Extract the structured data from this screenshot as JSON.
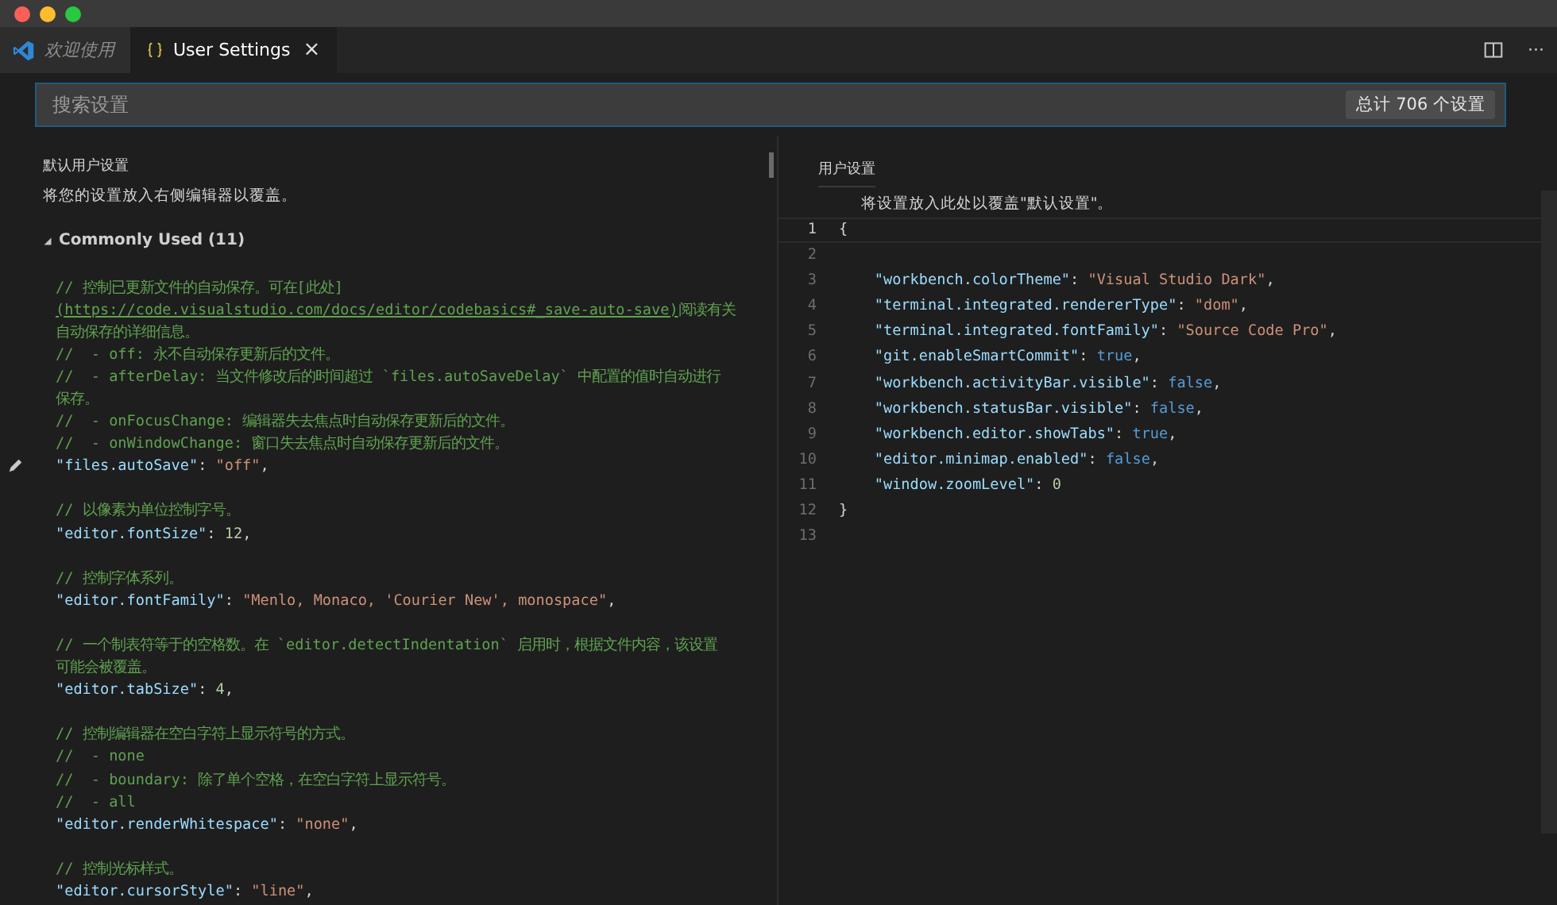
{
  "tabs": [
    {
      "label": "欢迎使用",
      "kind": "welcome",
      "selected": false
    },
    {
      "label": "User Settings",
      "kind": "settings",
      "selected": true,
      "close": "×"
    }
  ],
  "toolbar": {
    "more": "···"
  },
  "search": {
    "placeholder": "搜索设置",
    "count": "总计 706 个设置"
  },
  "default_pane": {
    "title": "默认用户设置",
    "hint": "将您的设置放入右侧编辑器以覆盖。",
    "group": {
      "label": "Commonly Used (11)",
      "expanded": true
    },
    "entries": [
      {
        "edited": true,
        "lines": [
          [
            {
              "kind": "comment",
              "text": "// 控制已更新文件的自动保存。可在[此处]"
            }
          ],
          [
            {
              "kind": "link",
              "text": "(https://code.visualstudio.com/docs/editor/codebasics#_save-auto-save)"
            },
            {
              "kind": "comment",
              "text": "阅读有关"
            }
          ],
          [
            {
              "kind": "comment",
              "text": "自动保存的详细信息。"
            }
          ],
          [
            {
              "kind": "comment",
              "text": "//  - off: 永不自动保存更新后的文件。"
            }
          ],
          [
            {
              "kind": "comment",
              "text": "//  - afterDelay: 当文件修改后的时间超过 `files.autoSaveDelay` 中配置的值时自动进行"
            }
          ],
          [
            {
              "kind": "comment",
              "text": "保存。"
            }
          ],
          [
            {
              "kind": "comment",
              "text": "//  - onFocusChange: 编辑器失去焦点时自动保存更新后的文件。"
            }
          ],
          [
            {
              "kind": "comment",
              "text": "//  - onWindowChange: 窗口失去焦点时自动保存更新后的文件。"
            }
          ],
          [
            {
              "kind": "key",
              "text": "\"files.autoSave\""
            },
            {
              "kind": "punct",
              "text": ": "
            },
            {
              "kind": "string",
              "text": "\"off\""
            },
            {
              "kind": "punct",
              "text": ","
            }
          ]
        ]
      },
      {
        "edited": false,
        "lines": [
          [
            {
              "kind": "comment",
              "text": "// 以像素为单位控制字号。"
            }
          ],
          [
            {
              "kind": "key",
              "text": "\"editor.fontSize\""
            },
            {
              "kind": "punct",
              "text": ": "
            },
            {
              "kind": "number",
              "text": "12"
            },
            {
              "kind": "punct",
              "text": ","
            }
          ]
        ]
      },
      {
        "edited": false,
        "lines": [
          [
            {
              "kind": "comment",
              "text": "// 控制字体系列。"
            }
          ],
          [
            {
              "kind": "key",
              "text": "\"editor.fontFamily\""
            },
            {
              "kind": "punct",
              "text": ": "
            },
            {
              "kind": "string",
              "text": "\"Menlo, Monaco, 'Courier New', monospace\""
            },
            {
              "kind": "punct",
              "text": ","
            }
          ]
        ]
      },
      {
        "edited": false,
        "lines": [
          [
            {
              "kind": "comment",
              "text": "// 一个制表符等于的空格数。在 `editor.detectIndentation` 启用时，根据文件内容，该设置"
            }
          ],
          [
            {
              "kind": "comment",
              "text": "可能会被覆盖。"
            }
          ],
          [
            {
              "kind": "key",
              "text": "\"editor.tabSize\""
            },
            {
              "kind": "punct",
              "text": ": "
            },
            {
              "kind": "number",
              "text": "4"
            },
            {
              "kind": "punct",
              "text": ","
            }
          ]
        ]
      },
      {
        "edited": false,
        "lines": [
          [
            {
              "kind": "comment",
              "text": "// 控制编辑器在空白字符上显示符号的方式。"
            }
          ],
          [
            {
              "kind": "comment",
              "text": "//  - none"
            }
          ],
          [
            {
              "kind": "comment",
              "text": "//  - boundary: 除了单个空格，在空白字符上显示符号。"
            }
          ],
          [
            {
              "kind": "comment",
              "text": "//  - all"
            }
          ],
          [
            {
              "kind": "key",
              "text": "\"editor.renderWhitespace\""
            },
            {
              "kind": "punct",
              "text": ": "
            },
            {
              "kind": "string",
              "text": "\"none\""
            },
            {
              "kind": "punct",
              "text": ","
            }
          ]
        ]
      },
      {
        "edited": false,
        "lines": [
          [
            {
              "kind": "comment",
              "text": "// 控制光标样式。"
            }
          ],
          [
            {
              "kind": "key",
              "text": "\"editor.cursorStyle\""
            },
            {
              "kind": "punct",
              "text": ": "
            },
            {
              "kind": "string",
              "text": "\"line\""
            },
            {
              "kind": "punct",
              "text": ","
            }
          ]
        ]
      }
    ]
  },
  "user_pane": {
    "title": "用户设置",
    "hint": "将设置放入此处以覆盖\"默认设置\"。",
    "lines": [
      {
        "number": "1",
        "current": true,
        "tokens": [
          {
            "kind": "punct",
            "text": "{"
          }
        ]
      },
      {
        "number": "2",
        "current": false
      },
      {
        "number": "3",
        "current": false,
        "tokens": [
          {
            "kind": "key",
            "text": "    \"workbench.colorTheme\""
          },
          {
            "kind": "punct",
            "text": ": "
          },
          {
            "kind": "string",
            "text": "\"Visual Studio Dark\""
          },
          {
            "kind": "punct",
            "text": ","
          }
        ]
      },
      {
        "number": "4",
        "current": false,
        "tokens": [
          {
            "kind": "key",
            "text": "    \"terminal.integrated.rendererType\""
          },
          {
            "kind": "punct",
            "text": ": "
          },
          {
            "kind": "string",
            "text": "\"dom\""
          },
          {
            "kind": "punct",
            "text": ","
          }
        ]
      },
      {
        "number": "5",
        "current": false,
        "tokens": [
          {
            "kind": "key",
            "text": "    \"terminal.integrated.fontFamily\""
          },
          {
            "kind": "punct",
            "text": ": "
          },
          {
            "kind": "string",
            "text": "\"Source Code Pro\""
          },
          {
            "kind": "punct",
            "text": ","
          }
        ]
      },
      {
        "number": "6",
        "current": false,
        "tokens": [
          {
            "kind": "key",
            "text": "    \"git.enableSmartCommit\""
          },
          {
            "kind": "punct",
            "text": ": "
          },
          {
            "kind": "bool",
            "text": "true"
          },
          {
            "kind": "punct",
            "text": ","
          }
        ]
      },
      {
        "number": "7",
        "current": false,
        "tokens": [
          {
            "kind": "key",
            "text": "    \"workbench.activityBar.visible\""
          },
          {
            "kind": "punct",
            "text": ": "
          },
          {
            "kind": "bool",
            "text": "false"
          },
          {
            "kind": "punct",
            "text": ","
          }
        ]
      },
      {
        "number": "8",
        "current": false,
        "tokens": [
          {
            "kind": "key",
            "text": "    \"workbench.statusBar.visible\""
          },
          {
            "kind": "punct",
            "text": ": "
          },
          {
            "kind": "bool",
            "text": "false"
          },
          {
            "kind": "punct",
            "text": ","
          }
        ]
      },
      {
        "number": "9",
        "current": false,
        "tokens": [
          {
            "kind": "key",
            "text": "    \"workbench.editor.showTabs\""
          },
          {
            "kind": "punct",
            "text": ": "
          },
          {
            "kind": "bool",
            "text": "true"
          },
          {
            "kind": "punct",
            "text": ","
          }
        ]
      },
      {
        "number": "10",
        "current": false,
        "tokens": [
          {
            "kind": "key",
            "text": "    \"editor.minimap.enabled\""
          },
          {
            "kind": "punct",
            "text": ": "
          },
          {
            "kind": "bool",
            "text": "false"
          },
          {
            "kind": "punct",
            "text": ","
          }
        ]
      },
      {
        "number": "11",
        "current": false,
        "tokens": [
          {
            "kind": "key",
            "text": "    \"window.zoomLevel\""
          },
          {
            "kind": "punct",
            "text": ": "
          },
          {
            "kind": "number",
            "text": "0"
          }
        ]
      },
      {
        "number": "12",
        "current": false,
        "tokens": [
          {
            "kind": "punct",
            "text": "}"
          }
        ]
      },
      {
        "number": "13",
        "current": false
      }
    ]
  }
}
